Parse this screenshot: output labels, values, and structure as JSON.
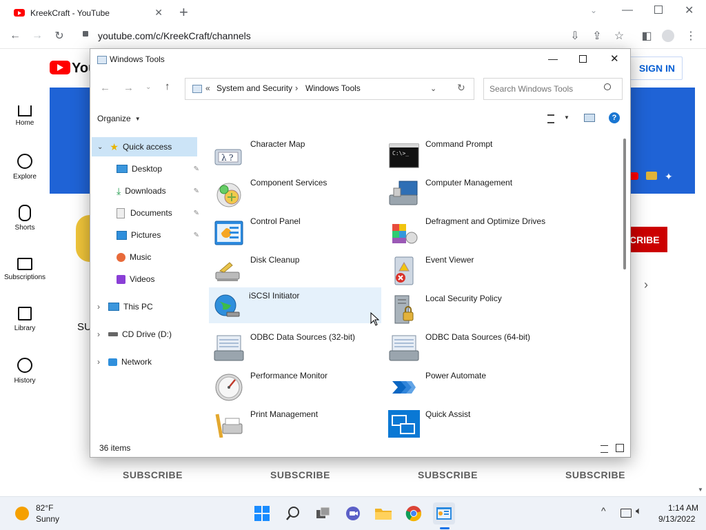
{
  "browser": {
    "tab_title": "KreekCraft - YouTube",
    "url": "youtube.com/c/KreekCraft/channels"
  },
  "youtube": {
    "sign_in": "SIGN IN",
    "subscribe_partial": "CRIBE",
    "partial_heading": "SU",
    "nav": [
      {
        "label": "Home",
        "icon": "home-icon"
      },
      {
        "label": "Explore",
        "icon": "compass-icon"
      },
      {
        "label": "Shorts",
        "icon": "shorts-icon"
      },
      {
        "label": "Subscriptions",
        "icon": "subscriptions-icon"
      },
      {
        "label": "Library",
        "icon": "library-icon"
      },
      {
        "label": "History",
        "icon": "history-icon"
      }
    ],
    "subscribe_buttons": [
      "SUBSCRIBE",
      "SUBSCRIBE",
      "SUBSCRIBE",
      "SUBSCRIBE"
    ],
    "colors": {
      "banner": "#1f63d6",
      "subscribe": "#cc0000",
      "brand": "#ff0000"
    }
  },
  "explorer": {
    "title": "Windows Tools",
    "breadcrumb": {
      "prefix": "«",
      "parent": "System and Security",
      "sep": "›",
      "current": "Windows Tools"
    },
    "search_placeholder": "Search Windows Tools",
    "organize": "Organize",
    "status": "36 items",
    "nav": {
      "quick_access": "Quick access",
      "pinned": [
        {
          "label": "Desktop",
          "icon": "desktop-icon",
          "pinned": true
        },
        {
          "label": "Downloads",
          "icon": "downloads-icon",
          "pinned": true
        },
        {
          "label": "Documents",
          "icon": "documents-icon",
          "pinned": true
        },
        {
          "label": "Pictures",
          "icon": "pictures-icon",
          "pinned": true
        },
        {
          "label": "Music",
          "icon": "music-icon",
          "pinned": false
        },
        {
          "label": "Videos",
          "icon": "videos-icon",
          "pinned": false
        }
      ],
      "roots": [
        {
          "label": "This PC",
          "icon": "this-pc-icon"
        },
        {
          "label": "CD Drive (D:)",
          "icon": "cd-drive-icon"
        },
        {
          "label": "Network",
          "icon": "network-icon"
        }
      ]
    },
    "items_left": [
      {
        "name": "Character Map",
        "icon": "character-map-icon"
      },
      {
        "name": "Component Services",
        "icon": "component-services-icon"
      },
      {
        "name": "Control Panel",
        "icon": "control-panel-icon"
      },
      {
        "name": "Disk Cleanup",
        "icon": "disk-cleanup-icon"
      },
      {
        "name": "iSCSI Initiator",
        "icon": "iscsi-initiator-icon"
      },
      {
        "name": "ODBC Data Sources (32-bit)",
        "icon": "odbc-32-icon"
      },
      {
        "name": "Performance Monitor",
        "icon": "performance-monitor-icon"
      },
      {
        "name": "Print Management",
        "icon": "print-management-icon"
      }
    ],
    "items_right": [
      {
        "name": "Command Prompt",
        "icon": "command-prompt-icon"
      },
      {
        "name": "Computer Management",
        "icon": "computer-management-icon"
      },
      {
        "name": "Defragment and Optimize Drives",
        "icon": "defrag-icon"
      },
      {
        "name": "Event Viewer",
        "icon": "event-viewer-icon"
      },
      {
        "name": "Local Security Policy",
        "icon": "local-security-policy-icon"
      },
      {
        "name": "ODBC Data Sources (64-bit)",
        "icon": "odbc-64-icon"
      },
      {
        "name": "Power Automate",
        "icon": "power-automate-icon"
      },
      {
        "name": "Quick Assist",
        "icon": "quick-assist-icon"
      }
    ],
    "hovered_item": "iSCSI Initiator"
  },
  "taskbar": {
    "weather_temp": "82°F",
    "weather_desc": "Sunny",
    "time": "1:14 AM",
    "date": "9/13/2022",
    "apps": [
      "start-icon",
      "search-icon",
      "task-view-icon",
      "teams-chat-icon",
      "file-explorer-icon",
      "chrome-icon",
      "control-panel-app-icon"
    ]
  }
}
